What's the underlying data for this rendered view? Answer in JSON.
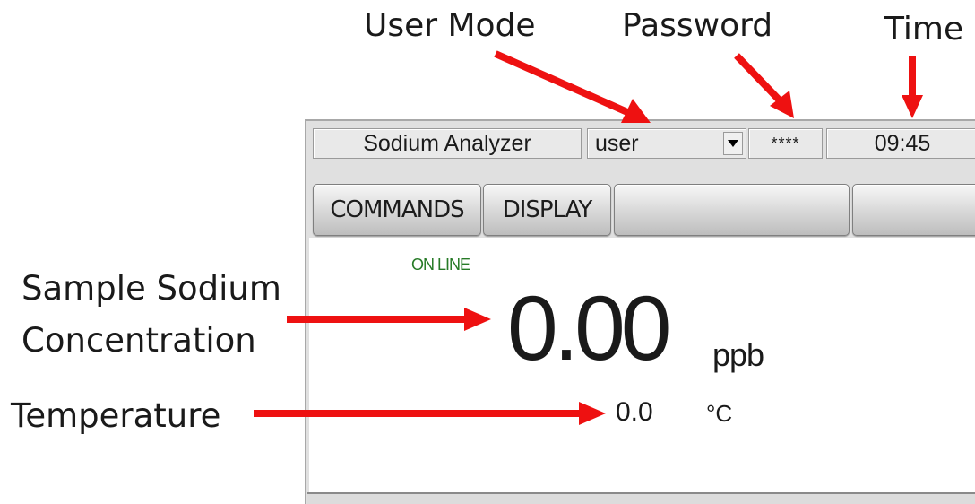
{
  "annotations": {
    "user_mode": "User Mode",
    "password": "Password",
    "time": "Time",
    "sample_sodium_line1": "Sample Sodium",
    "sample_sodium_line2": "Concentration",
    "temperature": "Temperature"
  },
  "header": {
    "title": "Sodium Analyzer",
    "user_mode_value": "user",
    "password_mask": "****",
    "time": "09:45"
  },
  "tabs": [
    {
      "label": "COMMANDS"
    },
    {
      "label": "DISPLAY"
    },
    {
      "label": ""
    },
    {
      "label": ""
    }
  ],
  "display": {
    "status": "ON LINE",
    "sodium_value": "0.00",
    "sodium_unit": "ppb",
    "temperature_value": "0.0",
    "temperature_unit": "°C"
  },
  "colors": {
    "arrow": "#ee1111",
    "status_text": "#267a26",
    "panel_frame": "#e0e0e0"
  }
}
